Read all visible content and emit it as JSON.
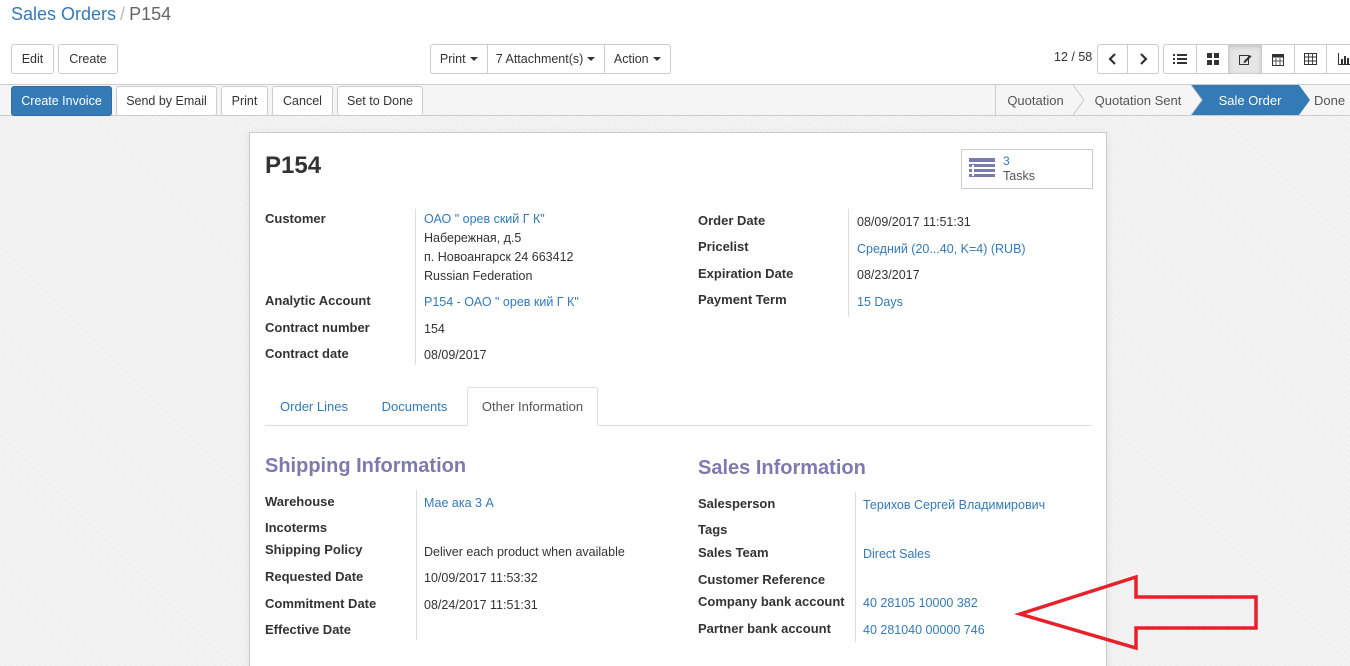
{
  "breadcrumb": {
    "parent": "Sales Orders",
    "separator": "/",
    "current": "P154"
  },
  "toolbar": {
    "edit": "Edit",
    "create": "Create",
    "print": "Print",
    "attachments": "7 Attachment(s)",
    "action": "Action",
    "pager": "12 / 58"
  },
  "statusbar": {
    "buttons": {
      "create_invoice": "Create Invoice",
      "send_email": "Send by Email",
      "print": "Print",
      "cancel": "Cancel",
      "set_done": "Set to Done"
    },
    "stages": [
      "Quotation",
      "Quotation Sent",
      "Sale Order",
      "Done"
    ],
    "active_stage": "Sale Order"
  },
  "record": {
    "name": "P154",
    "smart_button": {
      "count": "3",
      "label": "Tasks"
    },
    "left": {
      "customer_label": "Customer",
      "customer_name": "ОАО \"   ореʙ  ский Г   К\"",
      "customer_addr1": "Набережная, д.5",
      "customer_addr2": "п. Новоангарск 24 663412",
      "customer_addr3": "Russian Federation",
      "analytic_label": "Analytic Account",
      "analytic_value": "P154 - ОАО \"   ореʙ  кий Г  К\"",
      "contract_number_label": "Contract number",
      "contract_number_value": "154",
      "contract_date_label": "Contract date",
      "contract_date_value": "08/09/2017"
    },
    "right": {
      "order_date_label": "Order Date",
      "order_date_value": "08/09/2017 11:51:31",
      "pricelist_label": "Pricelist",
      "pricelist_value": "Средний (20...40, K=4) (RUB)",
      "expiration_label": "Expiration Date",
      "expiration_value": "08/23/2017",
      "payment_term_label": "Payment Term",
      "payment_term_value": "15 Days"
    },
    "tabs": [
      "Order Lines",
      "Documents",
      "Other Information"
    ],
    "active_tab": "Other Information",
    "shipping": {
      "title": "Shipping Information",
      "warehouse_label": "Warehouse",
      "warehouse_value": "Мае     ака 3   А",
      "incoterms_label": "Incoterms",
      "policy_label": "Shipping Policy",
      "policy_value": "Deliver each product when available",
      "requested_label": "Requested Date",
      "requested_value": "10/09/2017 11:53:32",
      "commitment_label": "Commitment Date",
      "commitment_value": "08/24/2017 11:51:31",
      "effective_label": "Effective Date"
    },
    "sales": {
      "title": "Sales Information",
      "salesperson_label": "Salesperson",
      "salesperson_value": "Терихов Сергей Владимирович",
      "tags_label": "Tags",
      "team_label": "Sales Team",
      "team_value": "Direct Sales",
      "customer_ref_label": "Customer Reference",
      "company_bank_label": "Company bank account",
      "company_bank_value": "40    28105  10000     382",
      "partner_bank_label": "Partner bank account",
      "partner_bank_value": "40    281040  00000   746"
    }
  },
  "colors": {
    "brand": "#337ab7",
    "section_title": "#7c7bad",
    "annotation_arrow": "#e8202a"
  }
}
